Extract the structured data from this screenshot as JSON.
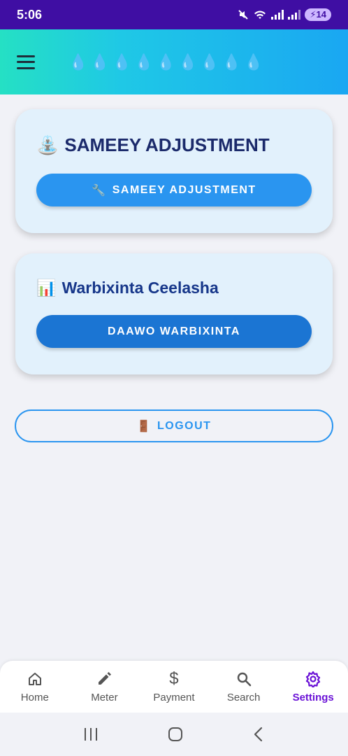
{
  "status_bar": {
    "time": "5:06",
    "battery": "14"
  },
  "app_bar": {
    "drops": "💧💧💧💧💧💧💧💧💧"
  },
  "cards": [
    {
      "icon": "⛲",
      "title": "SAMEEY ADJUSTMENT",
      "button_icon": "🔧",
      "button_label": "SAMEEY ADJUSTMENT"
    },
    {
      "icon": "📊",
      "title": "Warbixinta Ceelasha",
      "button_label": "DAAWO WARBIXINTA"
    }
  ],
  "logout": {
    "icon": "🚪",
    "label": "LOGOUT"
  },
  "bottom_nav": [
    {
      "label": "Home",
      "icon": "home-icon"
    },
    {
      "label": "Meter",
      "icon": "pencil-icon"
    },
    {
      "label": "Payment",
      "icon": "dollar-icon"
    },
    {
      "label": "Search",
      "icon": "search-icon"
    },
    {
      "label": "Settings",
      "icon": "gear-icon",
      "active": true
    }
  ],
  "colors": {
    "accent": "#6a12d6",
    "status_bar": "#3f0ea3",
    "button_primary": "#2a95f0",
    "button_secondary": "#1b75d3"
  }
}
